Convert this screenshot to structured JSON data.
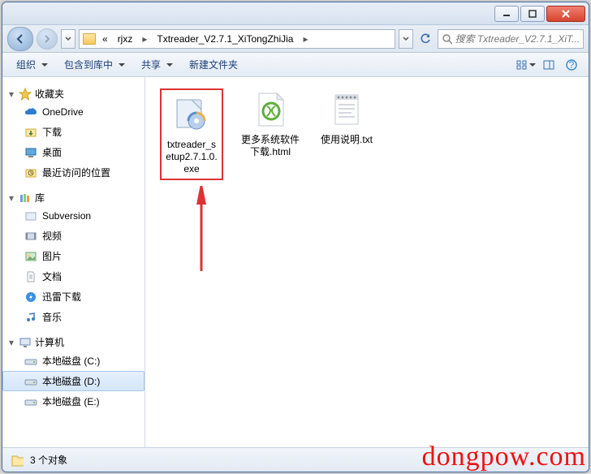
{
  "breadcrumbs": {
    "overflow_indicator": "«",
    "items": [
      "rjxz",
      "Txtreader_V2.7.1_XiTongZhiJia"
    ]
  },
  "search": {
    "placeholder": "搜索 Txtreader_V2.7.1_XiT..."
  },
  "toolbar": {
    "organize": "组织",
    "include": "包含到库中",
    "share": "共享",
    "new_folder": "新建文件夹"
  },
  "sidebar": {
    "favorites": {
      "label": "收藏夹",
      "items": [
        "OneDrive",
        "下载",
        "桌面",
        "最近访问的位置"
      ]
    },
    "libraries": {
      "label": "库",
      "items": [
        "Subversion",
        "视频",
        "图片",
        "文档",
        "迅雷下载",
        "音乐"
      ]
    },
    "computer": {
      "label": "计算机",
      "items": [
        "本地磁盘 (C:)",
        "本地磁盘 (D:)",
        "本地磁盘 (E:)"
      ],
      "selected_index": 1
    }
  },
  "files": [
    {
      "name": "txtreader_setup2.7.1.0.exe",
      "type": "installer",
      "highlighted": true
    },
    {
      "name": "更多系统软件下载.html",
      "type": "html"
    },
    {
      "name": "使用说明.txt",
      "type": "txt"
    }
  ],
  "status": {
    "count_text": "3 个对象"
  },
  "watermark": "dongpow.com"
}
